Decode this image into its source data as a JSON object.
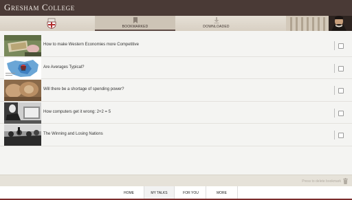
{
  "app": {
    "title": "Gresham College"
  },
  "tabs": [
    {
      "label": "BOOKMARKED",
      "icon": "bookmark-icon",
      "selected": true
    },
    {
      "label": "DOWNLOADED",
      "icon": "download-icon",
      "selected": false
    }
  ],
  "talks": [
    {
      "title": "How to make Western Economies more Competitive",
      "thumbnail": "money-cake-photo",
      "checked": false
    },
    {
      "title": "Are Averages Typical?",
      "thumbnail": "map-chart-slide",
      "checked": false
    },
    {
      "title": "Will there be a shortage of spending power?",
      "thumbnail": "banknotes-photo",
      "checked": false
    },
    {
      "title": "How computers get it wrong: 2+2 = 5",
      "thumbnail": "black-white-photo",
      "checked": false
    },
    {
      "title": "The Winning and Losing Nations",
      "thumbnail": "stock-market-crowd-photo",
      "checked": false
    }
  ],
  "footer": {
    "delete_hint": "Press to delete bookmark",
    "icon": "trash-icon"
  },
  "bottom_nav": {
    "items": [
      "HOME",
      "MY TALKS",
      "FOR YOU",
      "MORE"
    ],
    "active": "MY TALKS"
  },
  "colors": {
    "header": "#4a3a36",
    "accent": "#7b2c2c",
    "tabbar": "#dcd5c9"
  }
}
